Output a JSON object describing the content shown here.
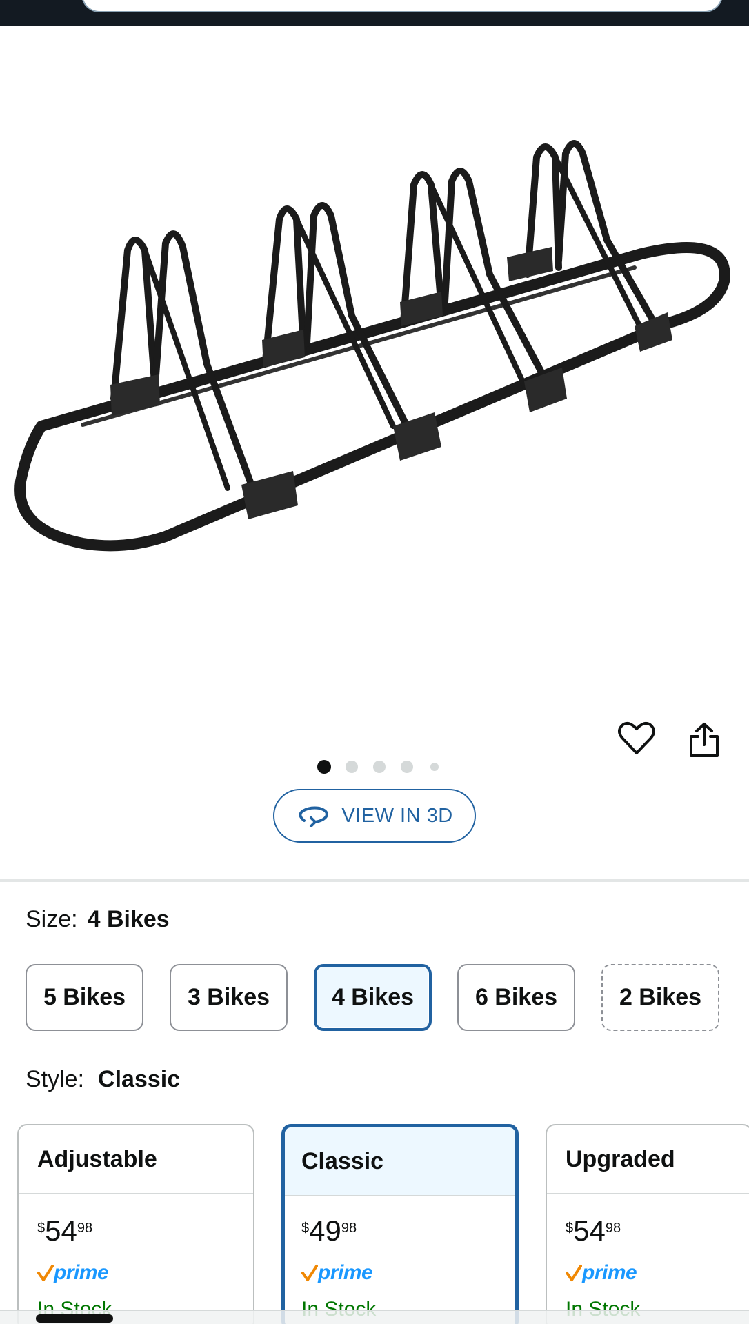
{
  "gallery": {
    "dot_count": 5,
    "active_dot": 0,
    "view3d_label": "VIEW IN 3D"
  },
  "variations": {
    "size_label": "Size:",
    "size_value": "4 Bikes",
    "size_options": [
      "5 Bikes",
      "3 Bikes",
      "4 Bikes",
      "6 Bikes",
      "2 Bikes"
    ],
    "style_label": "Style:",
    "style_value": "Classic",
    "style_options": [
      {
        "name": "Adjustable",
        "price_symbol": "$",
        "price_whole": "54",
        "price_fraction": "98",
        "prime": "prime",
        "stock": "In Stock"
      },
      {
        "name": "Classic",
        "price_symbol": "$",
        "price_whole": "49",
        "price_fraction": "98",
        "prime": "prime",
        "stock": "In Stock"
      },
      {
        "name": "Upgraded",
        "price_symbol": "$",
        "price_whole": "54",
        "price_fraction": "98",
        "prime": "prime",
        "stock": "In Stock"
      }
    ]
  },
  "colors": {
    "header_bg": "#131a22",
    "link_blue": "#2162a1",
    "selected_bg": "#edf8ff",
    "prime_blue": "#1a98ff",
    "prime_check": "#f08804",
    "in_stock_green": "#007600"
  },
  "icons": {
    "wishlist": "heart-icon",
    "share": "share-icon",
    "view3d": "rotate-3d-icon"
  }
}
